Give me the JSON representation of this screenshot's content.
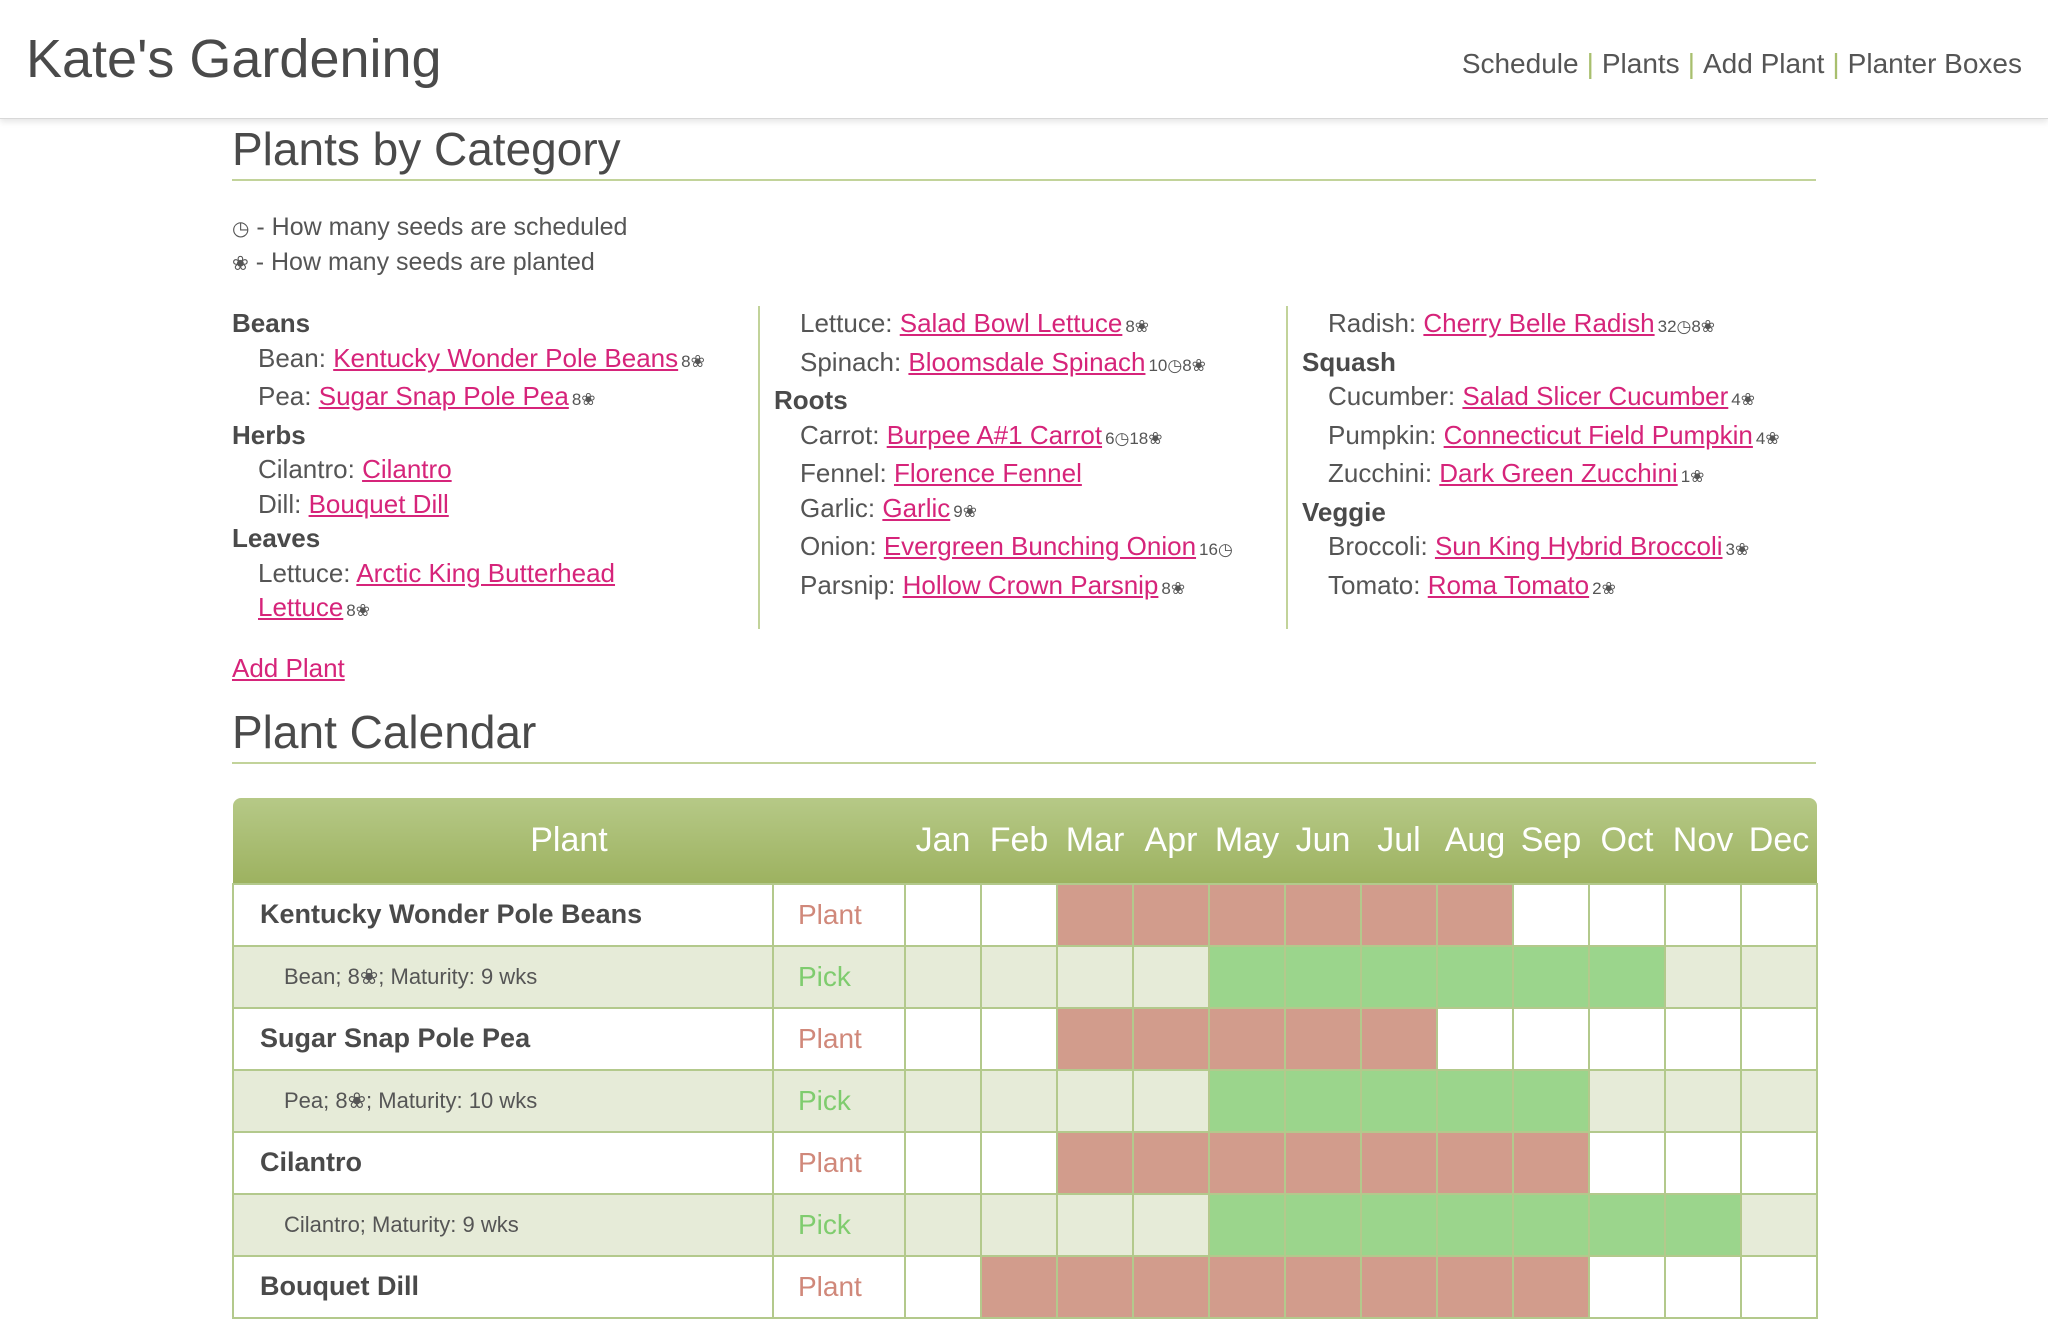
{
  "header": {
    "title": "Kate's Gardening",
    "nav": [
      "Schedule",
      "Plants",
      "Add Plant",
      "Planter Boxes"
    ],
    "separator": "|"
  },
  "plants_by_category": {
    "title": "Plants by Category",
    "legend": [
      {
        "symbol": "◷",
        "text": "- How many seeds are scheduled"
      },
      {
        "symbol": "❀",
        "text": "- How many seeds are planted"
      }
    ],
    "columns": [
      [
        {
          "heading": "Beans"
        },
        {
          "label": "Bean:",
          "link": "Kentucky Wonder Pole Beans",
          "count": "8❀"
        },
        {
          "label": "Pea:",
          "link": "Sugar Snap Pole Pea",
          "count": "8❀"
        },
        {
          "heading": "Herbs"
        },
        {
          "label": "Cilantro:",
          "link": "Cilantro",
          "count": ""
        },
        {
          "label": "Dill:",
          "link": "Bouquet Dill",
          "count": ""
        },
        {
          "heading": "Leaves"
        },
        {
          "label": "Lettuce:",
          "link": "Arctic King Butterhead Lettuce",
          "count": "8❀"
        }
      ],
      [
        {
          "label": "Lettuce:",
          "link": "Salad Bowl Lettuce",
          "count": "8❀"
        },
        {
          "label": "Spinach:",
          "link": "Bloomsdale Spinach",
          "count": "10◷8❀"
        },
        {
          "heading": "Roots"
        },
        {
          "label": "Carrot:",
          "link": "Burpee A#1 Carrot",
          "count": "6◷18❀"
        },
        {
          "label": "Fennel:",
          "link": "Florence Fennel",
          "count": ""
        },
        {
          "label": "Garlic:",
          "link": "Garlic",
          "count": "9❀"
        },
        {
          "label": "Onion:",
          "link": "Evergreen Bunching Onion",
          "count": "16◷"
        },
        {
          "label": "Parsnip:",
          "link": "Hollow Crown Parsnip",
          "count": "8❀"
        }
      ],
      [
        {
          "label": "Radish:",
          "link": "Cherry Belle Radish",
          "count": "32◷8❀"
        },
        {
          "heading": "Squash"
        },
        {
          "label": "Cucumber:",
          "link": "Salad Slicer Cucumber",
          "count": "4❀"
        },
        {
          "label": "Pumpkin:",
          "link": "Connecticut Field Pumpkin",
          "count": "4❀"
        },
        {
          "label": "Zucchini:",
          "link": "Dark Green Zucchini",
          "count": "1❀"
        },
        {
          "heading": "Veggie"
        },
        {
          "label": "Broccoli:",
          "link": "Sun King Hybrid Broccoli",
          "count": "3❀"
        },
        {
          "label": "Tomato:",
          "link": "Roma Tomato",
          "count": "2❀"
        }
      ]
    ],
    "add_plant_link": "Add Plant"
  },
  "plant_calendar": {
    "title": "Plant Calendar",
    "headers": {
      "plant": "Plant",
      "months": [
        "Jan",
        "Feb",
        "Mar",
        "Apr",
        "May",
        "Jun",
        "Jul",
        "Aug",
        "Sep",
        "Oct",
        "Nov",
        "Dec"
      ]
    },
    "rows": [
      {
        "kind": "plant",
        "name": "Kentucky Wonder Pole Beans",
        "type": "Plant",
        "months": [
          0,
          0,
          1,
          1,
          1,
          1,
          1,
          1,
          0,
          0,
          0,
          0
        ]
      },
      {
        "kind": "pick",
        "name": "Bean; 8❀; Maturity: 9 wks",
        "type": "Pick",
        "months": [
          0,
          0,
          0,
          0,
          1,
          1,
          1,
          1,
          1,
          1,
          0,
          0
        ]
      },
      {
        "kind": "plant",
        "name": "Sugar Snap Pole Pea",
        "type": "Plant",
        "months": [
          0,
          0,
          1,
          1,
          1,
          1,
          1,
          0,
          0,
          0,
          0,
          0
        ]
      },
      {
        "kind": "pick",
        "name": "Pea; 8❀; Maturity: 10 wks",
        "type": "Pick",
        "months": [
          0,
          0,
          0,
          0,
          1,
          1,
          1,
          1,
          1,
          0,
          0,
          0
        ]
      },
      {
        "kind": "plant",
        "name": "Cilantro",
        "type": "Plant",
        "months": [
          0,
          0,
          1,
          1,
          1,
          1,
          1,
          1,
          1,
          0,
          0,
          0
        ]
      },
      {
        "kind": "pick",
        "name": "Cilantro; Maturity: 9 wks",
        "type": "Pick",
        "months": [
          0,
          0,
          0,
          0,
          1,
          1,
          1,
          1,
          1,
          1,
          1,
          0
        ]
      },
      {
        "kind": "plant",
        "name": "Bouquet Dill",
        "type": "Plant",
        "months": [
          0,
          1,
          1,
          1,
          1,
          1,
          1,
          1,
          1,
          0,
          0,
          0
        ]
      }
    ]
  }
}
